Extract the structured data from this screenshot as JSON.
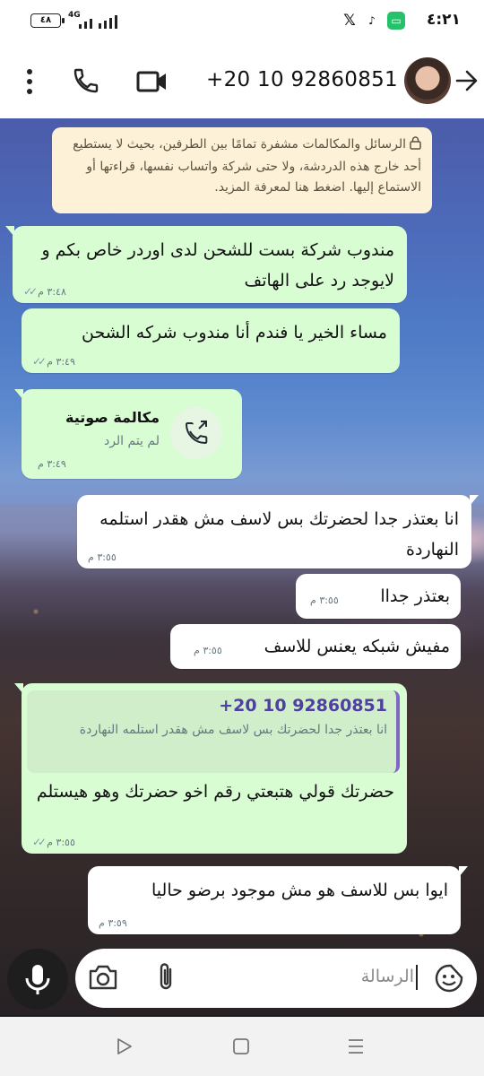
{
  "status_bar": {
    "time": "٤:٢١",
    "battery": "٤٨",
    "network": "4G",
    "notification_icons": [
      "x-icon",
      "tiktok-icon",
      "message-icon"
    ]
  },
  "header": {
    "contact_name": "+20 10 92860851",
    "icons": [
      "menu-icon",
      "phone-icon",
      "video-icon",
      "back-arrow-icon"
    ]
  },
  "encryption_notice": "الرسائل والمكالمات مشفرة تمامًا بين الطرفين، بحيث لا يستطيع أحد خارج هذه الدردشة، ولا حتى شركة واتساب نفسها، قراءتها أو الاستماع إليها. اضغط هنا لمعرفة المزيد.",
  "messages": [
    {
      "direction": "out",
      "text": "مندوب شركة بست للشحن لدى اوردر خاص بكم و لايوجد رد على الهاتف",
      "time": "٣:٤٨ م"
    },
    {
      "direction": "out",
      "text": "مساء الخير يا فندم أنا مندوب شركه الشحن",
      "time": "٣:٤٩ م"
    },
    {
      "direction": "out",
      "type": "call",
      "title": "مكالمة صوتية",
      "subtitle": "لم يتم الرد",
      "time": "٣:٤٩ م"
    },
    {
      "direction": "in",
      "text": "انا بعتذر جدا لحضرتك بس لاسف مش هقدر استلمه النهاردة",
      "time": "٣:٥٥ م"
    },
    {
      "direction": "in",
      "text": "بعتذر جداا",
      "time": "٣:٥٥ م"
    },
    {
      "direction": "in",
      "text": "مفيش شبكه يعنس للاسف",
      "time": "٣:٥٥ م"
    },
    {
      "direction": "out",
      "quoted_name": "+20 10 92860851",
      "quoted_text": "انا بعتذر جدا لحضرتك بس لاسف مش هقدر استلمه النهاردة",
      "text": "حضرتك قولي هتبعتي رقم اخو حضرتك وهو هيستلم",
      "time": "٣:٥٥ م"
    },
    {
      "direction": "in",
      "text": "ايوا بس للاسف هو مش موجود برضو حاليا",
      "time": "٣:٥٩ م"
    }
  ],
  "composer": {
    "placeholder": "الرسالة",
    "icons": [
      "mic-icon",
      "camera-icon",
      "attach-icon",
      "sticker-icon"
    ]
  },
  "nav_bar": {
    "icons": [
      "back-triangle-icon",
      "home-square-icon",
      "recents-menu-icon"
    ]
  },
  "colors": {
    "outgoing_bubble": "#d9fdd3",
    "incoming_bubble": "#ffffff",
    "encryption_bg": "#fdf1d7",
    "quote_bar": "#7f66c4"
  }
}
